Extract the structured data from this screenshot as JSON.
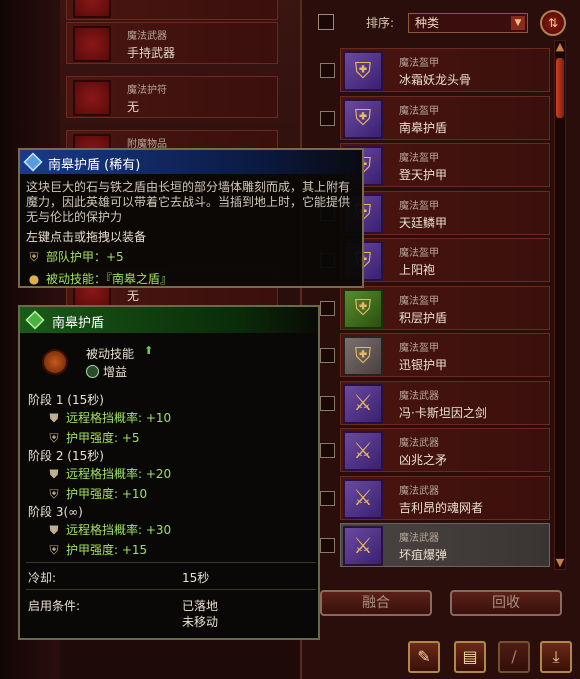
{
  "equip_slots": [
    {
      "category": "魔法武器",
      "value": "手持武器"
    },
    {
      "category": "魔法护符",
      "value": "无"
    },
    {
      "category": "附魔物品",
      "value": ""
    }
  ],
  "hidden_slot_value": "无",
  "sort": {
    "label": "排序:",
    "selected": "种类"
  },
  "items": [
    {
      "category": "魔法盔甲",
      "name": "冰霜妖龙头骨",
      "icon": "armor-icon"
    },
    {
      "category": "魔法盔甲",
      "name": "南皋护盾",
      "icon": "armor-icon"
    },
    {
      "category": "魔法盔甲",
      "name": "登天护甲",
      "icon": "armor-icon"
    },
    {
      "category": "魔法盔甲",
      "name": "天廷鳞甲",
      "icon": "armor-icon"
    },
    {
      "category": "魔法盔甲",
      "name": "上阳袍",
      "icon": "armor-icon"
    },
    {
      "category": "魔法盔甲",
      "name": "积层护盾",
      "icon": "armor-icon"
    },
    {
      "category": "魔法盔甲",
      "name": "迅银护甲",
      "icon": "armor-icon"
    },
    {
      "category": "魔法武器",
      "name": "冯·卡斯坦因之剑",
      "icon": "weapon-icon"
    },
    {
      "category": "魔法武器",
      "name": "凶兆之矛",
      "icon": "weapon-icon"
    },
    {
      "category": "魔法武器",
      "name": "吉利昂的魂网者",
      "icon": "weapon-icon"
    },
    {
      "category": "魔法武器",
      "name": "坏疽爆弹",
      "icon": "weapon-icon"
    }
  ],
  "buttons": {
    "merge": "融合",
    "recycle": "回收"
  },
  "tooltip1": {
    "title": "南皋护盾 (稀有)",
    "description": "这块巨大的石与铁之盾由长垣的部分墙体雕刻而成，其上附有魔力，因此英雄可以带着它去战斗。当插到地上时，它能提供无与伦比的保护力",
    "action": "左键点击或拖拽以装备",
    "line1": "部队护甲：+5",
    "line2": "被动技能：『南皋之盾』"
  },
  "tooltip2": {
    "title": "南皋护盾",
    "passive_label": "被动技能",
    "buff": "增益",
    "stages": [
      {
        "label": "阶段 1 (15秒)",
        "stats": [
          "远程格挡概率: +10",
          "护甲强度: +5"
        ]
      },
      {
        "label": "阶段 2 (15秒)",
        "stats": [
          "远程格挡概率: +20",
          "护甲强度: +10"
        ]
      },
      {
        "label": "阶段 3(∞)",
        "stats": [
          "远程格挡概率: +30",
          "护甲强度: +15"
        ]
      }
    ],
    "cooldown_label": "冷却:",
    "cooldown_value": "15秒",
    "condition_label": "启用条件:",
    "condition_values": [
      "已落地",
      "未移动"
    ]
  }
}
